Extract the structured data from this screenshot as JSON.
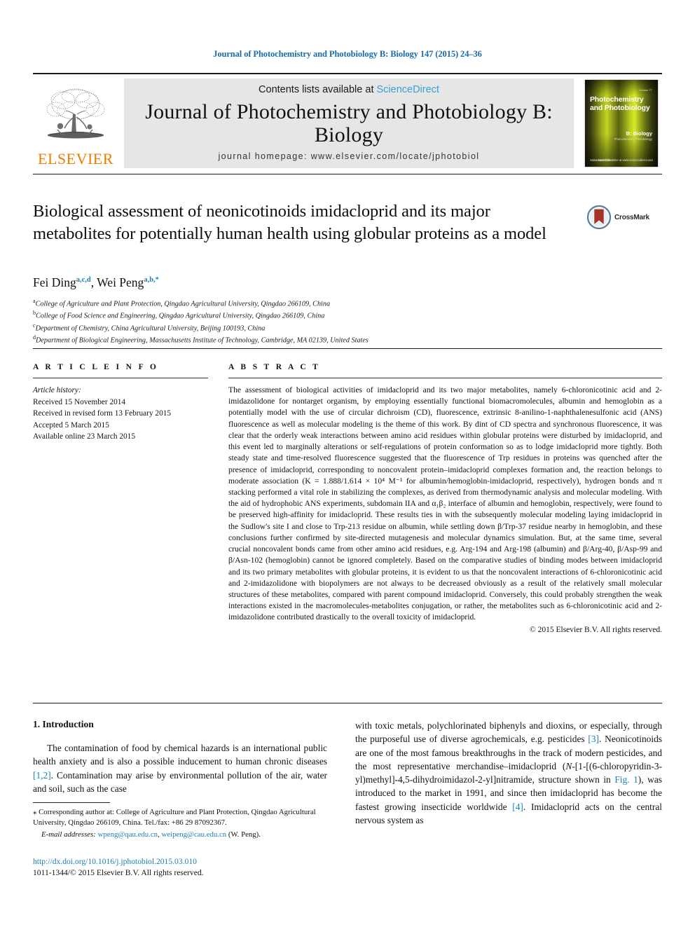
{
  "running_head": "Journal of Photochemistry and Photobiology B: Biology 147 (2015) 24–36",
  "masthead": {
    "publisher_logo_text": "ELSEVIER",
    "contents_prefix": "Contents lists available at ",
    "contents_link": "ScienceDirect",
    "journal_title": "Journal of Photochemistry and Photobiology B: Biology",
    "homepage": "journal homepage: www.elsevier.com/locate/jphotobiol",
    "cover": {
      "kicker": "Volume 77",
      "title": "Photochemistry and Photobiology",
      "subtitle": "B: Biology",
      "subtitle_small": "Photochemistry Photobiology",
      "foot_left": "Associate Editor",
      "foot_left_small": "Editor-in-Chief",
      "foot_right": "Available online at www.sciencedirect.com"
    }
  },
  "article": {
    "title": "Biological assessment of neonicotinoids imidacloprid and its major metabolites for potentially human health using globular proteins as a model",
    "crossmark_label": "CrossMark",
    "authors_html": "Fei Ding<sup>a,c,d</sup>, Wei Peng<sup>a,b,</sup><sup>*</sup>",
    "affiliations": [
      {
        "marker": "a",
        "text": "College of Agriculture and Plant Protection, Qingdao Agricultural University, Qingdao 266109, China"
      },
      {
        "marker": "b",
        "text": "College of Food Science and Engineering, Qingdao Agricultural University, Qingdao 266109, China"
      },
      {
        "marker": "c",
        "text": "Department of Chemistry, China Agricultural University, Beijing 100193, China"
      },
      {
        "marker": "d",
        "text": "Department of Biological Engineering, Massachusetts Institute of Technology, Cambridge, MA 02139, United States"
      }
    ]
  },
  "article_info": {
    "heading": "A R T I C L E   I N F O",
    "history_title": "Article history:",
    "history": [
      "Received 15 November 2014",
      "Received in revised form 13 February 2015",
      "Accepted 5 March 2015",
      "Available online 23 March 2015"
    ]
  },
  "abstract": {
    "heading": "A B S T R A C T",
    "text": "The assessment of biological activities of imidacloprid and its two major metabolites, namely 6-chloronicotinic acid and 2-imidazolidone for nontarget organism, by employing essentially functional biomacromolecules, albumin and hemoglobin as a potentially model with the use of circular dichroism (CD), fluorescence, extrinsic 8-anilino-1-naphthalenesulfonic acid (ANS) fluorescence as well as molecular modeling is the theme of this work. By dint of CD spectra and synchronous fluorescence, it was clear that the orderly weak interactions between amino acid residues within globular proteins were disturbed by imidacloprid, and this event led to marginally alterations or self-regulations of protein conformation so as to lodge imidacloprid more tightly. Both steady state and time-resolved fluorescence suggested that the fluorescence of Trp residues in proteins was quenched after the presence of imidacloprid, corresponding to noncovalent protein–imidacloprid complexes formation and, the reaction belongs to moderate association (K = 1.888/1.614 × 10⁴ M⁻¹ for albumin/hemoglobin-imidacloprid, respectively), hydrogen bonds and π stacking performed a vital role in stabilizing the complexes, as derived from thermodynamic analysis and molecular modeling. With the aid of hydrophobic ANS experiments, subdomain IIA and α₁β₂ interface of albumin and hemoglobin, respectively, were found to be preserved high-affinity for imidacloprid. These results ties in with the subsequently molecular modeling laying imidacloprid in the Sudlow's site I and close to Trp-213 residue on albumin, while settling down β/Trp-37 residue nearby in hemoglobin, and these conclusions further confirmed by site-directed mutagenesis and molecular dynamics simulation. But, at the same time, several crucial noncovalent bonds came from other amino acid residues, e.g. Arg-194 and Arg-198 (albumin) and β/Arg-40, β/Asp-99 and β/Asn-102 (hemoglobin) cannot be ignored completely. Based on the comparative studies of binding modes between imidacloprid and its two primary metabolites with globular proteins, it is evident to us that the noncovalent interactions of 6-chloronicotinic acid and 2-imidazolidone with biopolymers are not always to be decreased obviously as a result of the relatively small molecular structures of these metabolites, compared with parent compound imidacloprid. Conversely, this could probably strengthen the weak interactions existed in the macromolecules-metabolites conjugation, or rather, the metabolites such as 6-chloronicotinic acid and 2-imidazolidone contributed drastically to the overall toxicity of imidacloprid.",
    "copyright": "© 2015 Elsevier B.V. All rights reserved."
  },
  "introduction": {
    "heading": "1. Introduction",
    "col_left_html": "The contamination of food by chemical hazards is an international public health anxiety and is also a possible inducement to human chronic diseases <span class=\"ref\">[1,2]</span>. Contamination may arise by environmental pollution of the air, water and soil, such as the case",
    "col_right_html": "with toxic metals, polychlorinated biphenyls and dioxins, or especially, through the purposeful use of diverse agrochemicals, e.g. pesticides <span class=\"ref\">[3]</span>. Neonicotinoids are one of the most famous breakthroughs in the track of modern pesticides, and the most representative merchandise–imidacloprid (<i>N</i>-[1-[(6-chloropyridin-3-yl)methyl]-4,5-dihydroimidazol-2-yl]nitramide, structure shown in <span class=\"ref\">Fig. 1</span>), was introduced to the market in 1991, and since then imidacloprid has become the fastest growing insecticide worldwide <span class=\"ref\">[4]</span>. Imidacloprid acts on the central nervous system as"
  },
  "footnote": {
    "corresponding_html": "<span class=\"star\">⁎</span> Corresponding author at: College of Agriculture and Plant Protection, Qingdao Agricultural University, Qingdao 266109, China. Tel./fax: +86 29 87092367.",
    "email_html": "<span class=\"lbl\">E-mail addresses:</span> <span class=\"link\">wpeng@qau.edu.cn</span>, <span class=\"link\">weipeng@cau.edu.cn</span> (W. Peng)."
  },
  "footer": {
    "doi": "http://dx.doi.org/10.1016/j.jphotobiol.2015.03.010",
    "issn_line": "1011-1344/© 2015 Elsevier B.V. All rights reserved."
  },
  "colors": {
    "link": "#1a7fb5",
    "sciencedirect": "#3aa0d1",
    "elsevier_orange": "#ef7d00",
    "band_bg": "#e6e6e6"
  }
}
